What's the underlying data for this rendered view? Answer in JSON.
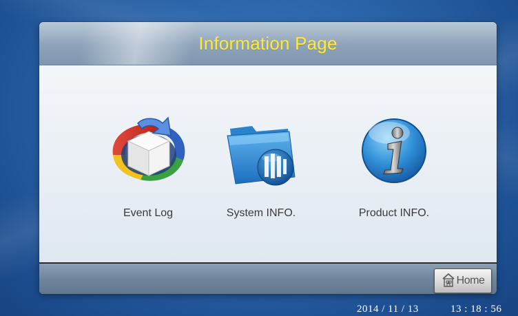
{
  "header": {
    "title": "Information Page"
  },
  "tiles": [
    {
      "label": "Event Log",
      "icon": "event-log-cube-icon"
    },
    {
      "label": "System INFO.",
      "icon": "system-folder-globe-icon"
    },
    {
      "label": "Product INFO.",
      "icon": "info-sphere-icon"
    }
  ],
  "footer": {
    "home_label": "Home",
    "home_icon": "house-icon"
  },
  "status": {
    "date": "2014 / 11 / 13",
    "time": "13 : 18 : 56"
  },
  "colors": {
    "title": "#ffea3a",
    "background": "#2a63a8",
    "panel": "#e9eff5"
  }
}
